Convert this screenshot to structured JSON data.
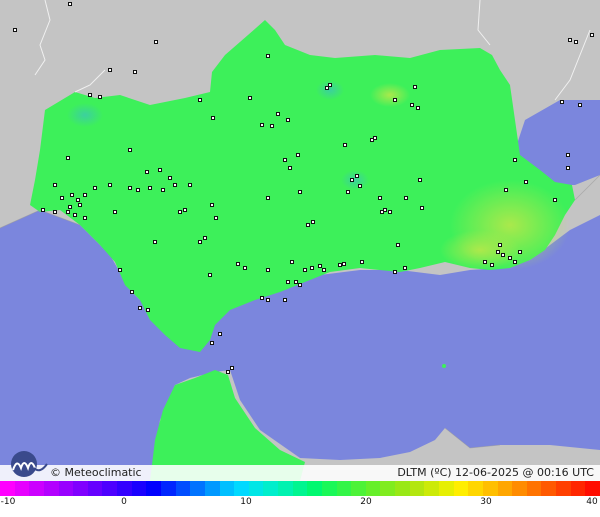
{
  "map": {
    "colors": {
      "sea": "#7b86dd",
      "land_foreign": "#c4c4c4",
      "region": "#3df05a",
      "warm_patch": "#a8e84a",
      "cool_patch": "#3cd89a",
      "stations": "#111111"
    }
  },
  "footer": {
    "credit": "© Meteoclimatic",
    "stamp": "DLTM (ºC)  12-06-2025 @ 00:16 UTC",
    "logo": "m"
  },
  "scale": {
    "ticks": [
      "-10",
      "0",
      "10",
      "20",
      "30",
      "40"
    ],
    "colors": [
      "#ff00ff",
      "#e600ff",
      "#cc00ff",
      "#b300ff",
      "#9900ff",
      "#8000ff",
      "#6600ff",
      "#4d00ff",
      "#3300ff",
      "#1a00ff",
      "#0000ff",
      "#0026ff",
      "#004dff",
      "#0073ff",
      "#0099ff",
      "#00bfff",
      "#00d9ff",
      "#00e6e6",
      "#00eecc",
      "#00f2b0",
      "#00f590",
      "#00f870",
      "#1af858",
      "#33f547",
      "#4df238",
      "#66ef2a",
      "#80ec1f",
      "#99e816",
      "#b3e60f",
      "#ccea08",
      "#e6ef03",
      "#ffee00",
      "#ffd600",
      "#ffbf00",
      "#ffa600",
      "#ff8c00",
      "#ff7300",
      "#ff5900",
      "#ff3f00",
      "#ff2600",
      "#ff0d00"
    ]
  }
}
